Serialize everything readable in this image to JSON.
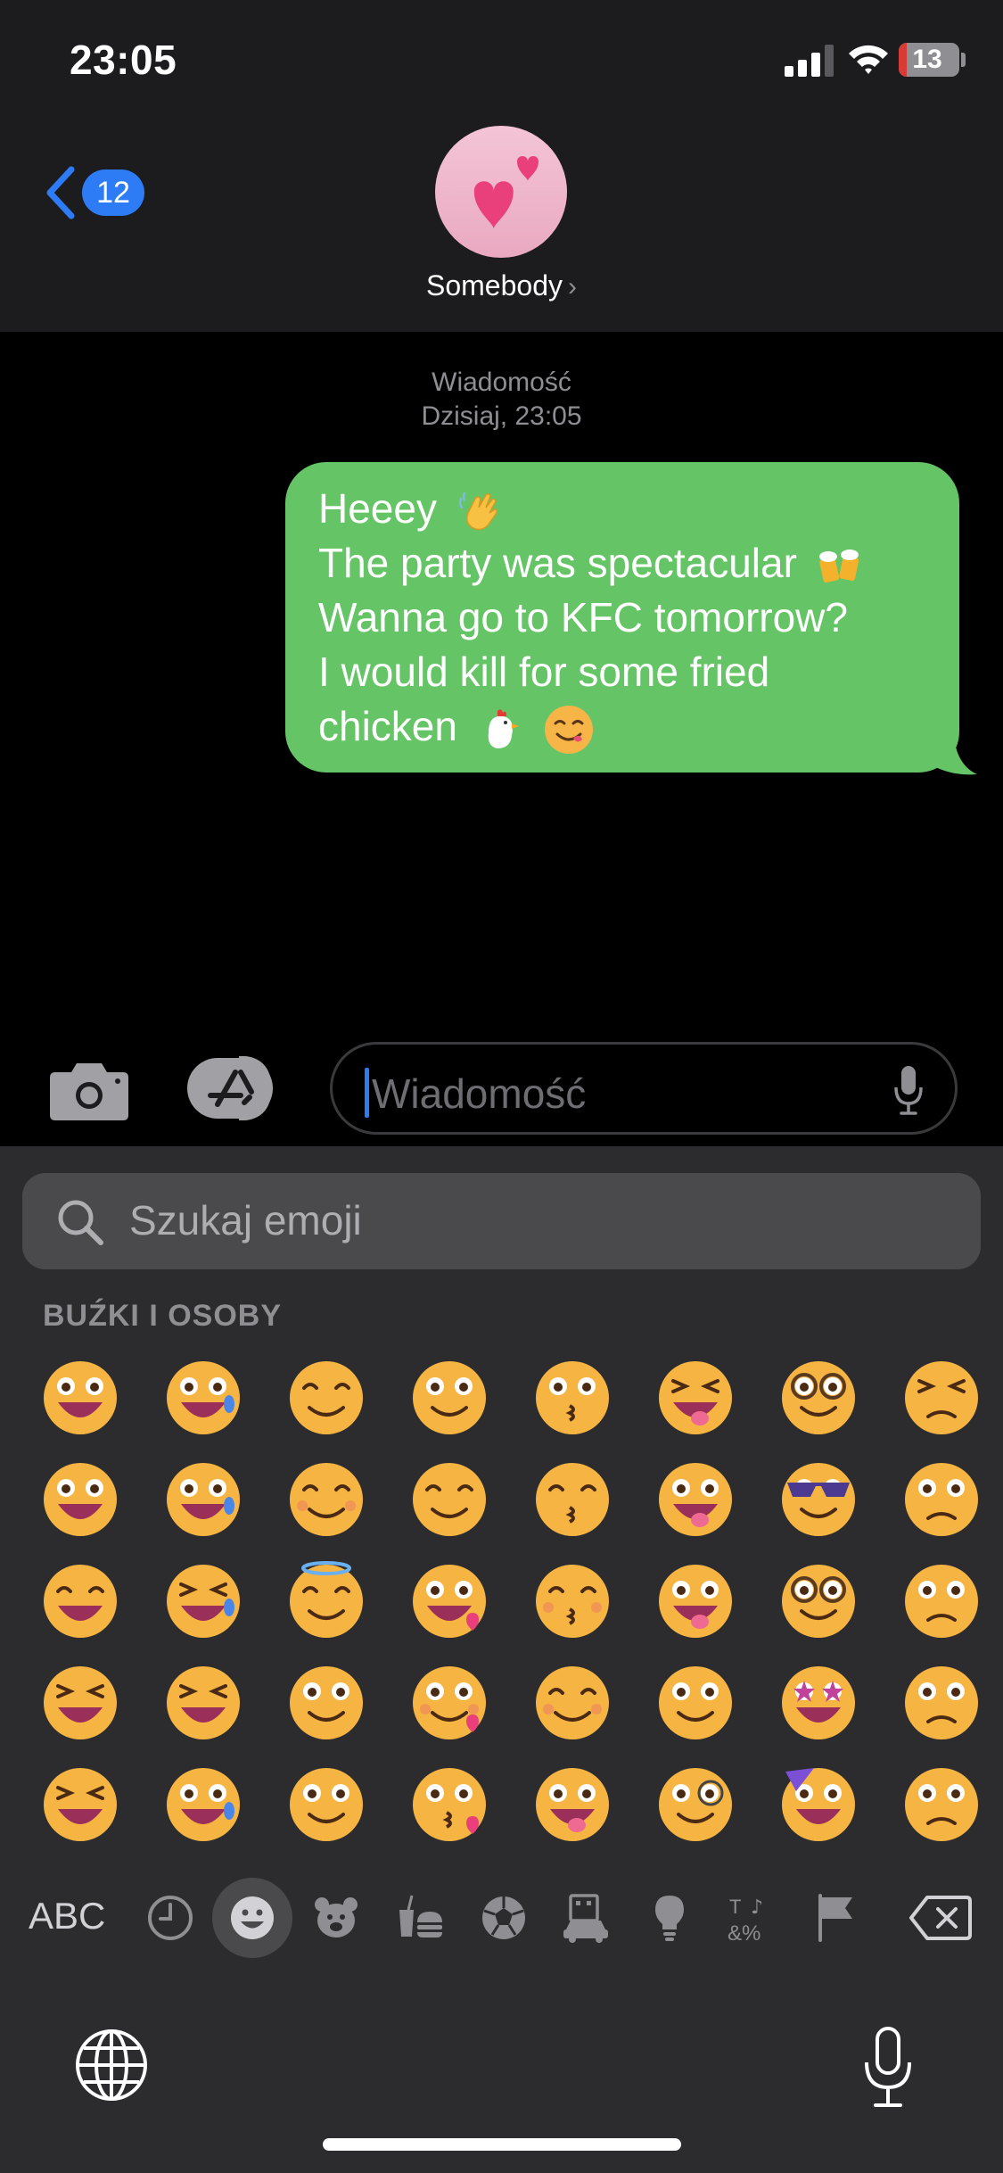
{
  "status_bar": {
    "time": "23:05",
    "battery_level": "13",
    "battery_fraction": 0.13,
    "icons": [
      "signal-icon",
      "wifi-icon",
      "battery-icon"
    ]
  },
  "header": {
    "back_badge": "12",
    "contact_name": "Somebody",
    "contact_chevron": "›",
    "avatar_icon": "two-hearts-icon"
  },
  "conversation": {
    "meta_label": "Wiadomość",
    "meta_time": "Dzisiaj, 23:05",
    "message": {
      "line1": "Heeey",
      "line2": "The party was spectacular",
      "line3": "Wanna go to KFC tomorrow?",
      "line4": "I would kill for some fried",
      "line5": "chicken",
      "emojis": [
        "waving-hand-icon",
        "beer-mugs-icon",
        "chicken-icon",
        "yum-face-icon"
      ]
    }
  },
  "input": {
    "placeholder": "Wiadomość",
    "buttons": [
      "camera-icon",
      "app-store-icon",
      "dictation-mic-icon"
    ]
  },
  "keyboard": {
    "search_placeholder": "Szukaj emoji",
    "section_title": "BUŹKI I OSOBY",
    "abc_label": "ABC",
    "categories": [
      "recent-clock-icon",
      "smileys-icon",
      "animals-icon",
      "food-icon",
      "activity-icon",
      "travel-icon",
      "objects-icon",
      "symbols-icon",
      "flags-icon"
    ],
    "active_category": "smileys-icon",
    "emoji_rows": [
      [
        "grinning-face-big-eyes",
        "face-holding-back-tears",
        "smiling-face-smiling-eyes",
        "winking-face",
        "kissing-face",
        "squinting-face-tongue",
        "nerd-face",
        "face-rolling-eyes"
      ],
      [
        "grinning-face",
        "grinning-face-sweat",
        "smiling-face-blush",
        "relieved-face",
        "kissing-face-smiling-eyes",
        "winking-face-tongue",
        "smiling-face-sunglasses",
        "unamused-face"
      ],
      [
        "beaming-face",
        "face-tears-of-joy",
        "smiling-face-halo",
        "heart-eyes-face",
        "kissing-face-closed-eyes",
        "zany-face",
        "disguised-face",
        "disappointed-face"
      ],
      [
        "grinning-squinting-face",
        "rolling-on-floor-laughing",
        "slightly-smiling-face",
        "smiling-face-hearts",
        "face-savoring-food",
        "face-raised-eyebrow",
        "star-struck-face",
        "pensive-face"
      ],
      [
        "grinning-squinting-big-mouth",
        "smiling-face-tear",
        "upside-down-face",
        "face-blowing-kiss",
        "face-tongue",
        "face-monocle",
        "partying-face",
        "worried-face"
      ]
    ]
  }
}
